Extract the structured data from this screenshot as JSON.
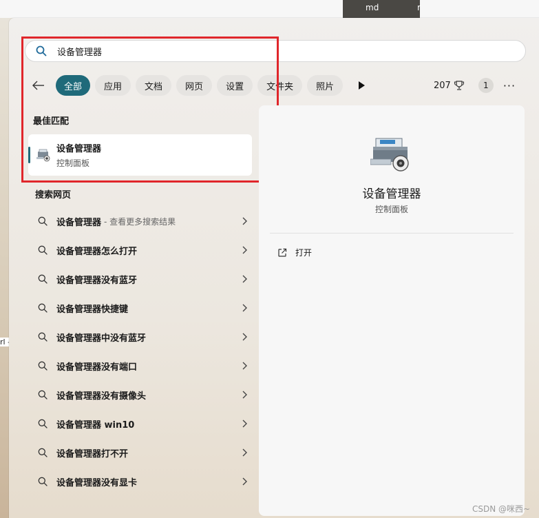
{
  "background": {
    "thumb_label_1": "md",
    "thumb_label_2": "r",
    "left_edge_text": "rl -"
  },
  "search": {
    "query": "设备管理器",
    "icon": "search-icon"
  },
  "filters": {
    "items": [
      "全部",
      "应用",
      "文档",
      "网页",
      "设置",
      "文件夹",
      "照片"
    ],
    "active_index": 0
  },
  "toolbar": {
    "points": "207",
    "badge": "1",
    "more": "···"
  },
  "best_match": {
    "section_title": "最佳匹配",
    "name": "设备管理器",
    "subtitle": "控制面板"
  },
  "web_search": {
    "section_title": "搜索网页",
    "items": [
      {
        "text": "设备管理器",
        "hint": "- 查看更多搜索结果"
      },
      {
        "text": "设备管理器怎么打开",
        "hint": ""
      },
      {
        "text": "设备管理器没有蓝牙",
        "hint": ""
      },
      {
        "text": "设备管理器快捷键",
        "hint": ""
      },
      {
        "text": "设备管理器中没有蓝牙",
        "hint": ""
      },
      {
        "text": "设备管理器没有端口",
        "hint": ""
      },
      {
        "text": "设备管理器没有摄像头",
        "hint": ""
      },
      {
        "text": "设备管理器 win10",
        "hint": ""
      },
      {
        "text": "设备管理器打不开",
        "hint": ""
      },
      {
        "text": "设备管理器没有显卡",
        "hint": ""
      }
    ]
  },
  "detail": {
    "name": "设备管理器",
    "subtitle": "控制面板",
    "action_open": "打开"
  },
  "colors": {
    "accent": "#1f6a7a",
    "highlight_box": "#e0262b"
  },
  "watermark": "CSDN @咪西~"
}
